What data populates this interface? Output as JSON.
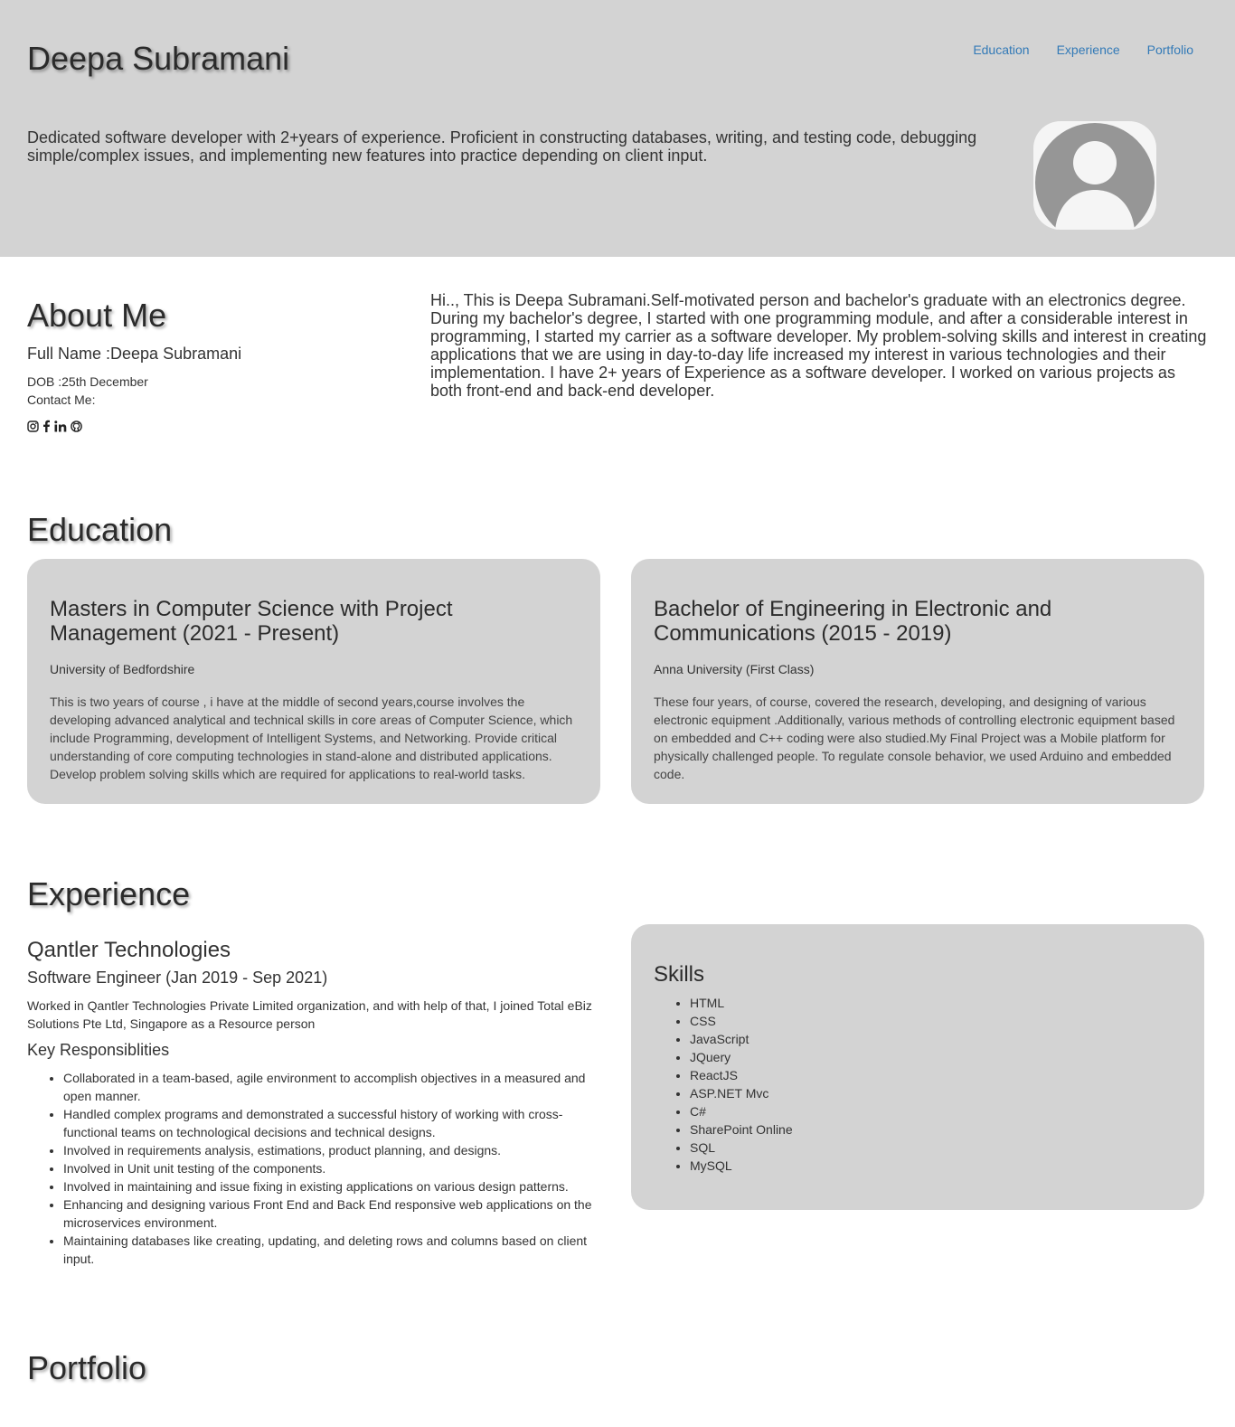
{
  "header": {
    "name": "Deepa Subramani",
    "nav": [
      "Education",
      "Experience",
      "Portfolio"
    ],
    "tagline": "Dedicated software developer with 2+years of experience. Proficient in constructing databases, writing, and testing code, debugging simple/complex issues, and implementing new features into practice depending on client input."
  },
  "about": {
    "title": "About Me",
    "full_name": "Full Name :Deepa Subramani",
    "dob": "DOB :25th December",
    "contact": "Contact Me:",
    "social_icons": [
      "instagram-icon",
      "facebook-icon",
      "linkedin-icon",
      "github-icon"
    ],
    "text": "Hi.., This is Deepa Subramani.Self-motivated person and bachelor's graduate with an electronics degree. During my bachelor's degree, I started with one programming module, and after a considerable interest in programming, I started my carrier as a software developer. My problem-solving skills and interest in creating applications that we are using in day-to-day life increased my interest in various technologies and their implementation. I have 2+ years of Experience as a software developer. I worked on various projects as both front-end and back-end developer."
  },
  "education": {
    "title": "Education",
    "items": [
      {
        "degree": "Masters in Computer Science with Project Management (2021 - Present)",
        "institution": "University of Bedfordshire",
        "description": "This is two years of course , i have at the middle of second years,course involves the developing advanced analytical and technical skills in core areas of Computer Science, which include Programming, development of Intelligent Systems, and Networking. Provide critical understanding of core computing technologies in stand-alone and distributed applications. Develop problem solving skills which are required for applications to real-world tasks."
      },
      {
        "degree": "Bachelor of Engineering in Electronic and Communications (2015 - 2019)",
        "institution": "Anna University (First Class)",
        "description": "These four years, of course, covered the research, developing, and designing of various electronic equipment .Additionally, various methods of controlling electronic equipment based on embedded and C++ coding were also studied.My Final Project was a Mobile platform for physically challenged people. To regulate console behavior, we used Arduino and embedded code."
      }
    ]
  },
  "experience": {
    "title": "Experience",
    "company": "Qantler Technologies",
    "role": "Software Engineer (Jan 2019 - Sep 2021)",
    "description": "Worked in Qantler Technologies Private Limited organization, and with help of that, I joined Total eBiz Solutions Pte Ltd, Singapore as a Resource person",
    "responsibilities_title": "Key Responsiblities",
    "responsibilities": [
      "Collaborated in a team-based, agile environment to accomplish objectives in a measured and open manner.",
      "Handled complex programs and demonstrated a successful history of working with cross-functional teams on technological decisions and technical designs.",
      "Involved in requirements analysis, estimations, product planning, and designs.",
      "Involved in Unit unit testing of the components.",
      "Involved in maintaining and issue fixing in existing applications on various design patterns.",
      "Enhancing and designing various Front End and Back End responsive web applications on the microservices environment.",
      "Maintaining databases like creating, updating, and deleting rows and columns based on client input."
    ]
  },
  "skills": {
    "title": "Skills",
    "items": [
      "HTML",
      "CSS",
      "JavaScript",
      "JQuery",
      "ReactJS",
      "ASP.NET Mvc",
      "C#",
      "SharePoint Online",
      "SQL",
      "MySQL"
    ]
  },
  "portfolio": {
    "title": "Portfolio"
  },
  "colors": {
    "header_bg": "#d3d3d3",
    "card_bg": "#d3d3d3",
    "link": "#337ab7"
  }
}
